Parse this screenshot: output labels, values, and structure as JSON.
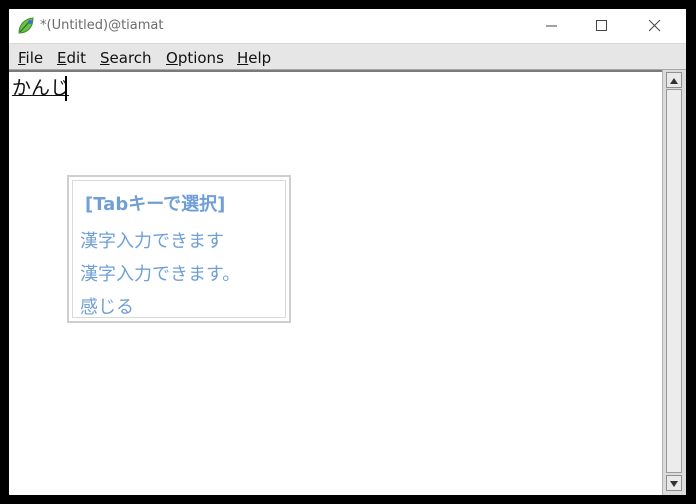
{
  "window": {
    "title": "*(Untitled)@tiamat",
    "app_icon": "leaf-icon",
    "controls": [
      "minimize-icon",
      "maximize-icon",
      "close-icon"
    ]
  },
  "menubar": {
    "items": [
      {
        "mnemonic": "F",
        "rest": "ile"
      },
      {
        "mnemonic": "E",
        "rest": "dit"
      },
      {
        "mnemonic": "S",
        "rest": "earch"
      },
      {
        "mnemonic": "O",
        "rest": "ptions"
      },
      {
        "mnemonic": "H",
        "rest": "elp"
      }
    ]
  },
  "editor": {
    "preedit_text": "かんじ"
  },
  "candidates": {
    "header": "[Tabキーで選択]",
    "items": [
      "漢字入力できます",
      "漢字入力できます。",
      "感じる"
    ],
    "color": "#6f9fd6"
  }
}
